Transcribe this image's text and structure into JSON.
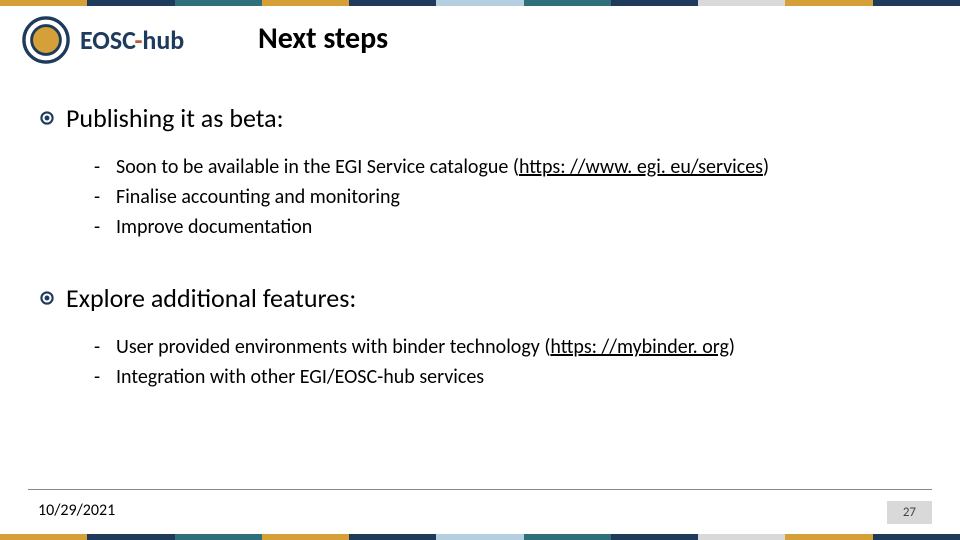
{
  "logo": {
    "main": "EOSC",
    "dash": "-",
    "suffix": "hub"
  },
  "title": "Next steps",
  "sections": [
    {
      "heading": "Publishing it as beta:",
      "items": [
        {
          "pre": "Soon to be available in the EGI Service catalogue (",
          "link": "https: //www. egi. eu/services",
          "post": ")"
        },
        {
          "text": "Finalise accounting and monitoring"
        },
        {
          "text": "Improve documentation"
        }
      ]
    },
    {
      "heading": "Explore additional features:",
      "items": [
        {
          "pre": "User provided environments with binder technology (",
          "link": "https: //mybinder. org",
          "post": ")"
        },
        {
          "text": "Integration with other EGI/EOSC-hub services"
        }
      ]
    }
  ],
  "footer": {
    "date": "10/29/2021",
    "page": "27"
  }
}
